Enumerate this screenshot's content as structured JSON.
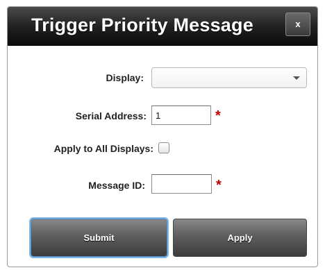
{
  "dialog": {
    "title": "Trigger Priority Message",
    "close_label": "x"
  },
  "form": {
    "display_label": "Display:",
    "display_value": "",
    "serial_address_label": "Serial Address:",
    "serial_address_value": "1",
    "apply_all_label": "Apply to All Displays:",
    "apply_all_checked": false,
    "message_id_label": "Message ID:",
    "message_id_value": "",
    "required_marker": "*"
  },
  "buttons": {
    "submit_label": "Submit",
    "apply_label": "Apply"
  },
  "colors": {
    "required": "#c40000",
    "titlebar": "#1f1f1f",
    "button": "#5e5e5e",
    "focus_ring": "#7fb6e6"
  }
}
